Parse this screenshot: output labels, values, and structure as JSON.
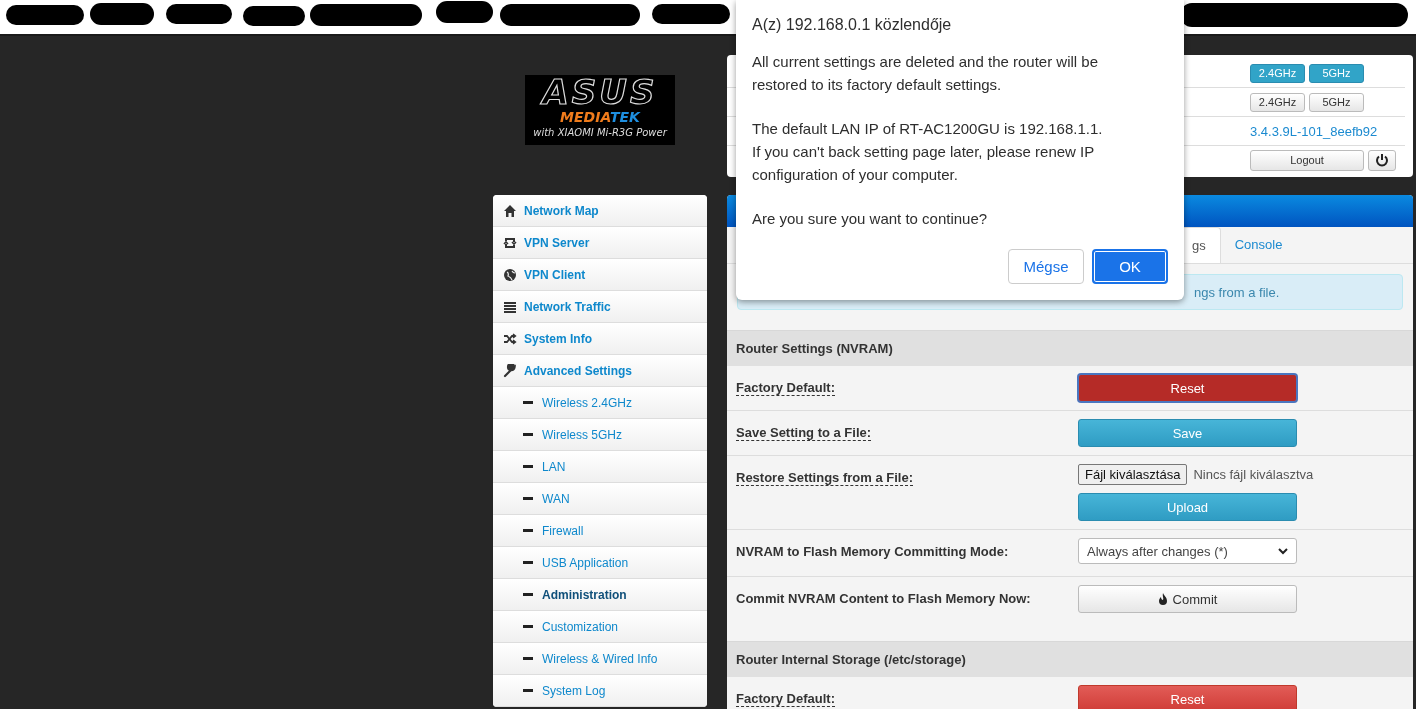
{
  "logo": {
    "brand": "ASUS",
    "chip_a": "MEDIA",
    "chip_b": "TEK",
    "tagline": "with XIAOMI Mi-R3G Power"
  },
  "sidebar": {
    "items": [
      {
        "kind": "main",
        "label": "Network Map",
        "selected": false
      },
      {
        "kind": "main",
        "label": "VPN Server",
        "selected": false
      },
      {
        "kind": "main",
        "label": "VPN Client",
        "selected": false
      },
      {
        "kind": "main",
        "label": "Network Traffic",
        "selected": false
      },
      {
        "kind": "main",
        "label": "System Info",
        "selected": false
      },
      {
        "kind": "main",
        "label": "Advanced Settings",
        "selected": false
      },
      {
        "kind": "sub",
        "label": "Wireless 2.4GHz",
        "selected": false
      },
      {
        "kind": "sub",
        "label": "Wireless 5GHz",
        "selected": false
      },
      {
        "kind": "sub",
        "label": "LAN",
        "selected": false
      },
      {
        "kind": "sub",
        "label": "WAN",
        "selected": false
      },
      {
        "kind": "sub",
        "label": "Firewall",
        "selected": false
      },
      {
        "kind": "sub",
        "label": "USB Application",
        "selected": false
      },
      {
        "kind": "sub",
        "label": "Administration",
        "selected": true
      },
      {
        "kind": "sub",
        "label": "Customization",
        "selected": false
      },
      {
        "kind": "sub",
        "label": "Wireless & Wired Info",
        "selected": false
      },
      {
        "kind": "sub",
        "label": "System Log",
        "selected": false
      }
    ]
  },
  "info_card": {
    "rows": [
      {
        "kind": "toggles",
        "buttons": [
          {
            "label": "2.4GHz",
            "on": true
          },
          {
            "label": "5GHz",
            "on": true
          }
        ]
      },
      {
        "kind": "toggles",
        "buttons": [
          {
            "label": "2.4GHz",
            "on": false
          },
          {
            "label": "5GHz",
            "on": false
          }
        ]
      },
      {
        "kind": "link",
        "text": "3.4.3.9L-101_8eefb92"
      },
      {
        "kind": "logout",
        "text": "Logout"
      }
    ]
  },
  "tabs": [
    {
      "label": "gs",
      "selected": true
    },
    {
      "label": "Console",
      "selected": false
    }
  ],
  "alert": "ngs from a file.",
  "sections": [
    {
      "title": "Router Settings (NVRAM)",
      "rows": [
        {
          "label": "Factory Default:",
          "underlined": true,
          "kind": "reset",
          "button": "Reset",
          "focused": true
        },
        {
          "label": "Save Setting to a File:",
          "underlined": true,
          "kind": "save",
          "button": "Save"
        },
        {
          "label": "Restore Settings from a File:",
          "underlined": true,
          "kind": "file",
          "file_button": "Fájl kiválasztása",
          "file_status": "Nincs fájl kiválasztva",
          "button": "Upload"
        },
        {
          "label": "NVRAM to Flash Memory Committing Mode:",
          "underlined": false,
          "kind": "select",
          "value": "Always after changes (*)"
        },
        {
          "label": "Commit NVRAM Content to Flash Memory Now:",
          "underlined": false,
          "kind": "commit",
          "button": "Commit"
        }
      ]
    },
    {
      "title": "Router Internal Storage (/etc/storage)",
      "rows": [
        {
          "label": "Factory Default:",
          "underlined": true,
          "kind": "reset",
          "button": "Reset",
          "focused": false
        }
      ]
    }
  ],
  "dialog": {
    "title": "A(z) 192.168.0.1 közlendője",
    "paragraphs": [
      [
        "All current settings are deleted and the router will be restored to its factory default settings."
      ],
      [
        "The default LAN IP of RT-AC1200GU is 192.168.1.1.",
        "If you can't back setting page later, please renew IP configuration of your computer."
      ],
      [
        "Are you sure you want to continue?"
      ]
    ],
    "buttons": [
      {
        "label": "Mégse",
        "primary": false
      },
      {
        "label": "OK",
        "primary": true
      }
    ]
  }
}
